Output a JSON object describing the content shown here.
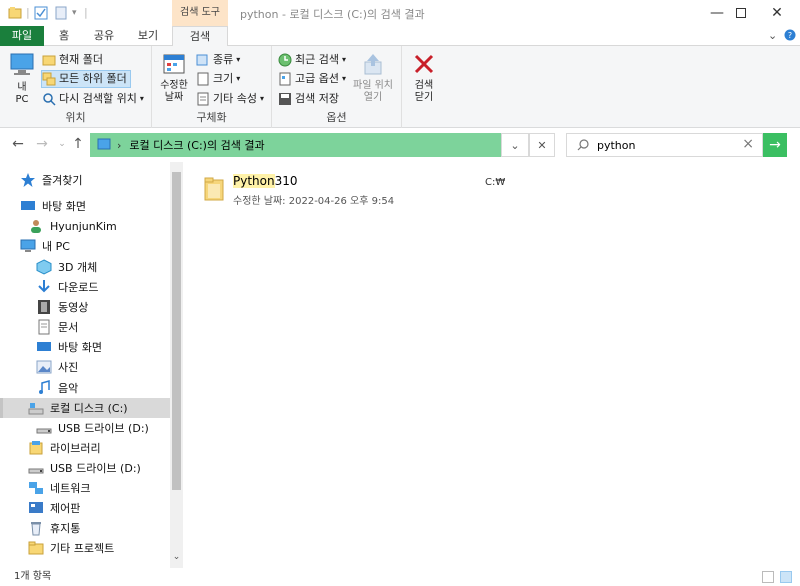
{
  "titlebar": {
    "context_tab": "검색 도구",
    "title": "python - 로컬 디스크 (C:)의 검색 결과"
  },
  "tabs": {
    "file": "파일",
    "home": "홈",
    "share": "공유",
    "view": "보기",
    "search": "검색"
  },
  "ribbon": {
    "location": {
      "this_pc": "내\nPC",
      "current_folder": "현재 폴더",
      "all_subfolders": "모든 하위 폴더",
      "search_again": "다시 검색할 위치",
      "label": "위치"
    },
    "refine": {
      "date_modified": "수정한\n날짜",
      "kind": "종류",
      "size": "크기",
      "other_properties": "기타 속성",
      "label": "구체화"
    },
    "options": {
      "recent_searches": "최근 검색",
      "advanced_options": "고급 옵션",
      "save_search": "검색 저장",
      "open_file_location": "파일 위치\n열기",
      "label": "옵션"
    },
    "close": {
      "label": "검색\n닫기"
    }
  },
  "address": {
    "path": "로컬 디스크 (C:)의 검색 결과",
    "search_value": "python"
  },
  "navpane": {
    "items": [
      {
        "label": "즐겨찾기",
        "icon": "star-icon"
      },
      {
        "label": "바탕 화면",
        "icon": "desktop-icon"
      },
      {
        "label": "HyunjunKim",
        "icon": "user-icon"
      },
      {
        "label": "내 PC",
        "icon": "pc-icon"
      },
      {
        "label": "3D 개체",
        "icon": "cube-icon"
      },
      {
        "label": "다운로드",
        "icon": "download-icon"
      },
      {
        "label": "동영상",
        "icon": "video-icon"
      },
      {
        "label": "문서",
        "icon": "document-icon"
      },
      {
        "label": "바탕 화면",
        "icon": "desktop-icon"
      },
      {
        "label": "사진",
        "icon": "pictures-icon"
      },
      {
        "label": "음악",
        "icon": "music-icon"
      },
      {
        "label": "로컬 디스크 (C:)",
        "icon": "drive-icon"
      },
      {
        "label": "USB 드라이브 (D:)",
        "icon": "usb-drive-icon"
      },
      {
        "label": "라이브러리",
        "icon": "library-icon"
      },
      {
        "label": "USB 드라이브 (D:)",
        "icon": "usb-drive-icon"
      },
      {
        "label": "네트워크",
        "icon": "network-icon"
      },
      {
        "label": "제어판",
        "icon": "control-panel-icon"
      },
      {
        "label": "휴지통",
        "icon": "recycle-bin-icon"
      },
      {
        "label": "기타 프로젝트",
        "icon": "folder-icon"
      }
    ]
  },
  "results": [
    {
      "name_match": "Python",
      "name_rest": "310",
      "meta_label": "수정한 날짜:",
      "meta_value": "2022-04-26 오후 9:54",
      "location": "C:₩"
    }
  ],
  "status": {
    "count": "1개 항목"
  }
}
